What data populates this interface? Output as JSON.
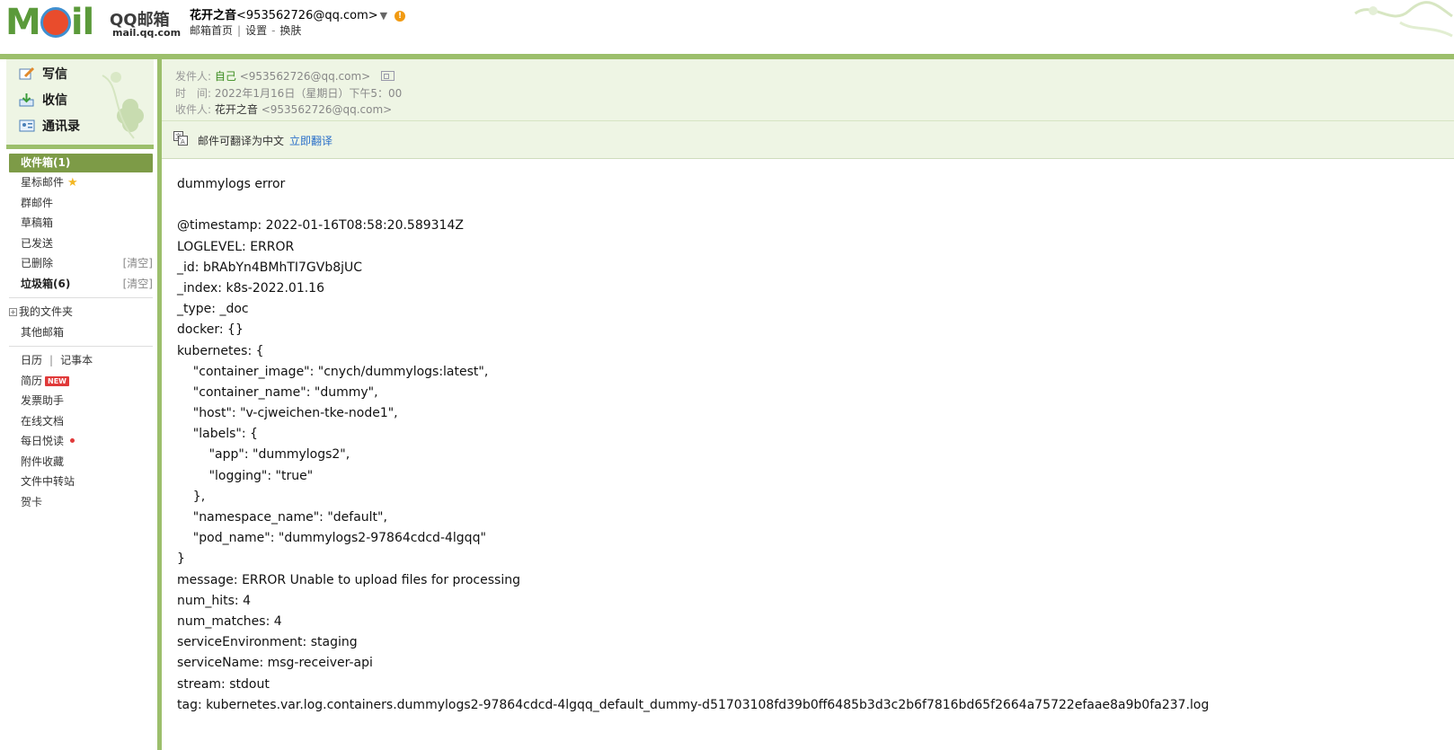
{
  "header": {
    "logo_moil": "M",
    "logo_moil_rest": "il",
    "logo_brand": "QQ邮箱",
    "logo_domain": "mail.qq.com",
    "account_name": "花开之音",
    "account_email": "<953562726@qq.com>",
    "alert_glyph": "!",
    "links": {
      "home": "邮箱首页",
      "sep1": "|",
      "settings": "设置",
      "sep2": "-",
      "skin": "换肤"
    }
  },
  "sidebar": {
    "actions": {
      "compose": "写信",
      "receive": "收信",
      "contacts": "通讯录"
    },
    "folders": [
      {
        "label": "收件箱(1)"
      },
      {
        "label": "星标邮件",
        "star": "★"
      },
      {
        "label": "群邮件"
      },
      {
        "label": "草稿箱"
      },
      {
        "label": "已发送"
      },
      {
        "label": "已删除",
        "action": "[清空]"
      },
      {
        "label": "垃圾箱(6)",
        "action": "[清空]"
      }
    ],
    "my_folders": {
      "toggle": "+",
      "label": "我的文件夹"
    },
    "other_mailboxes": "其他邮箱",
    "apps": {
      "calendar": "日历",
      "sep": "|",
      "notes": "记事本",
      "resume": "简历",
      "resume_badge": "NEW",
      "invoice": "发票助手",
      "docs": "在线文档",
      "daily": "每日悦读",
      "attachments": "附件收藏",
      "transfer": "文件中转站",
      "cards": "贺卡"
    }
  },
  "mail": {
    "partial_line": "",
    "from_label": "发件人:",
    "from_name": "自己",
    "from_email": "<953562726@qq.com>",
    "time_label": "时　间:",
    "time_value": "2022年1月16日（星期日）下午5：00",
    "to_label": "收件人:",
    "to_name": "花开之音",
    "to_email": "<953562726@qq.com>",
    "translate_text": "邮件可翻译为中文",
    "translate_link": "立即翻译",
    "body_lines": [
      "dummylogs error",
      "",
      "@timestamp: 2022-01-16T08:58:20.589314Z",
      "LOGLEVEL: ERROR",
      "_id: bRAbYn4BMhTI7GVb8jUC",
      "_index: k8s-2022.01.16",
      "_type: _doc",
      "docker: {}",
      "kubernetes: {",
      "    \"container_image\": \"cnych/dummylogs:latest\",",
      "    \"container_name\": \"dummy\",",
      "    \"host\": \"v-cjweichen-tke-node1\",",
      "    \"labels\": {",
      "        \"app\": \"dummylogs2\",",
      "        \"logging\": \"true\"",
      "    },",
      "    \"namespace_name\": \"default\",",
      "    \"pod_name\": \"dummylogs2-97864cdcd-4lgqq\"",
      "}",
      "message: ERROR Unable to upload files for processing",
      "num_hits: 4",
      "num_matches: 4",
      "serviceEnvironment: staging",
      "serviceName: msg-receiver-api",
      "stream: stdout",
      "tag: kubernetes.var.log.containers.dummylogs2-97864cdcd-4lgqq_default_dummy-d51703108fd39b0ff6485b3d3c2b6f7816bd65f2664a75722efaae8a9b0fa237.log"
    ]
  },
  "colors": {
    "theme_green": "#9cbf6c",
    "panel_green": "#eef5e4",
    "active_folder": "#7d9b47",
    "link_blue": "#2a6fc9",
    "sender_green": "#3a8c1e"
  },
  "icons": {
    "compose": "compose-pencil-icon",
    "receive": "inbox-download-icon",
    "contacts": "contact-card-icon",
    "translate": "translate-icon",
    "card": "contact-card-small-icon"
  }
}
